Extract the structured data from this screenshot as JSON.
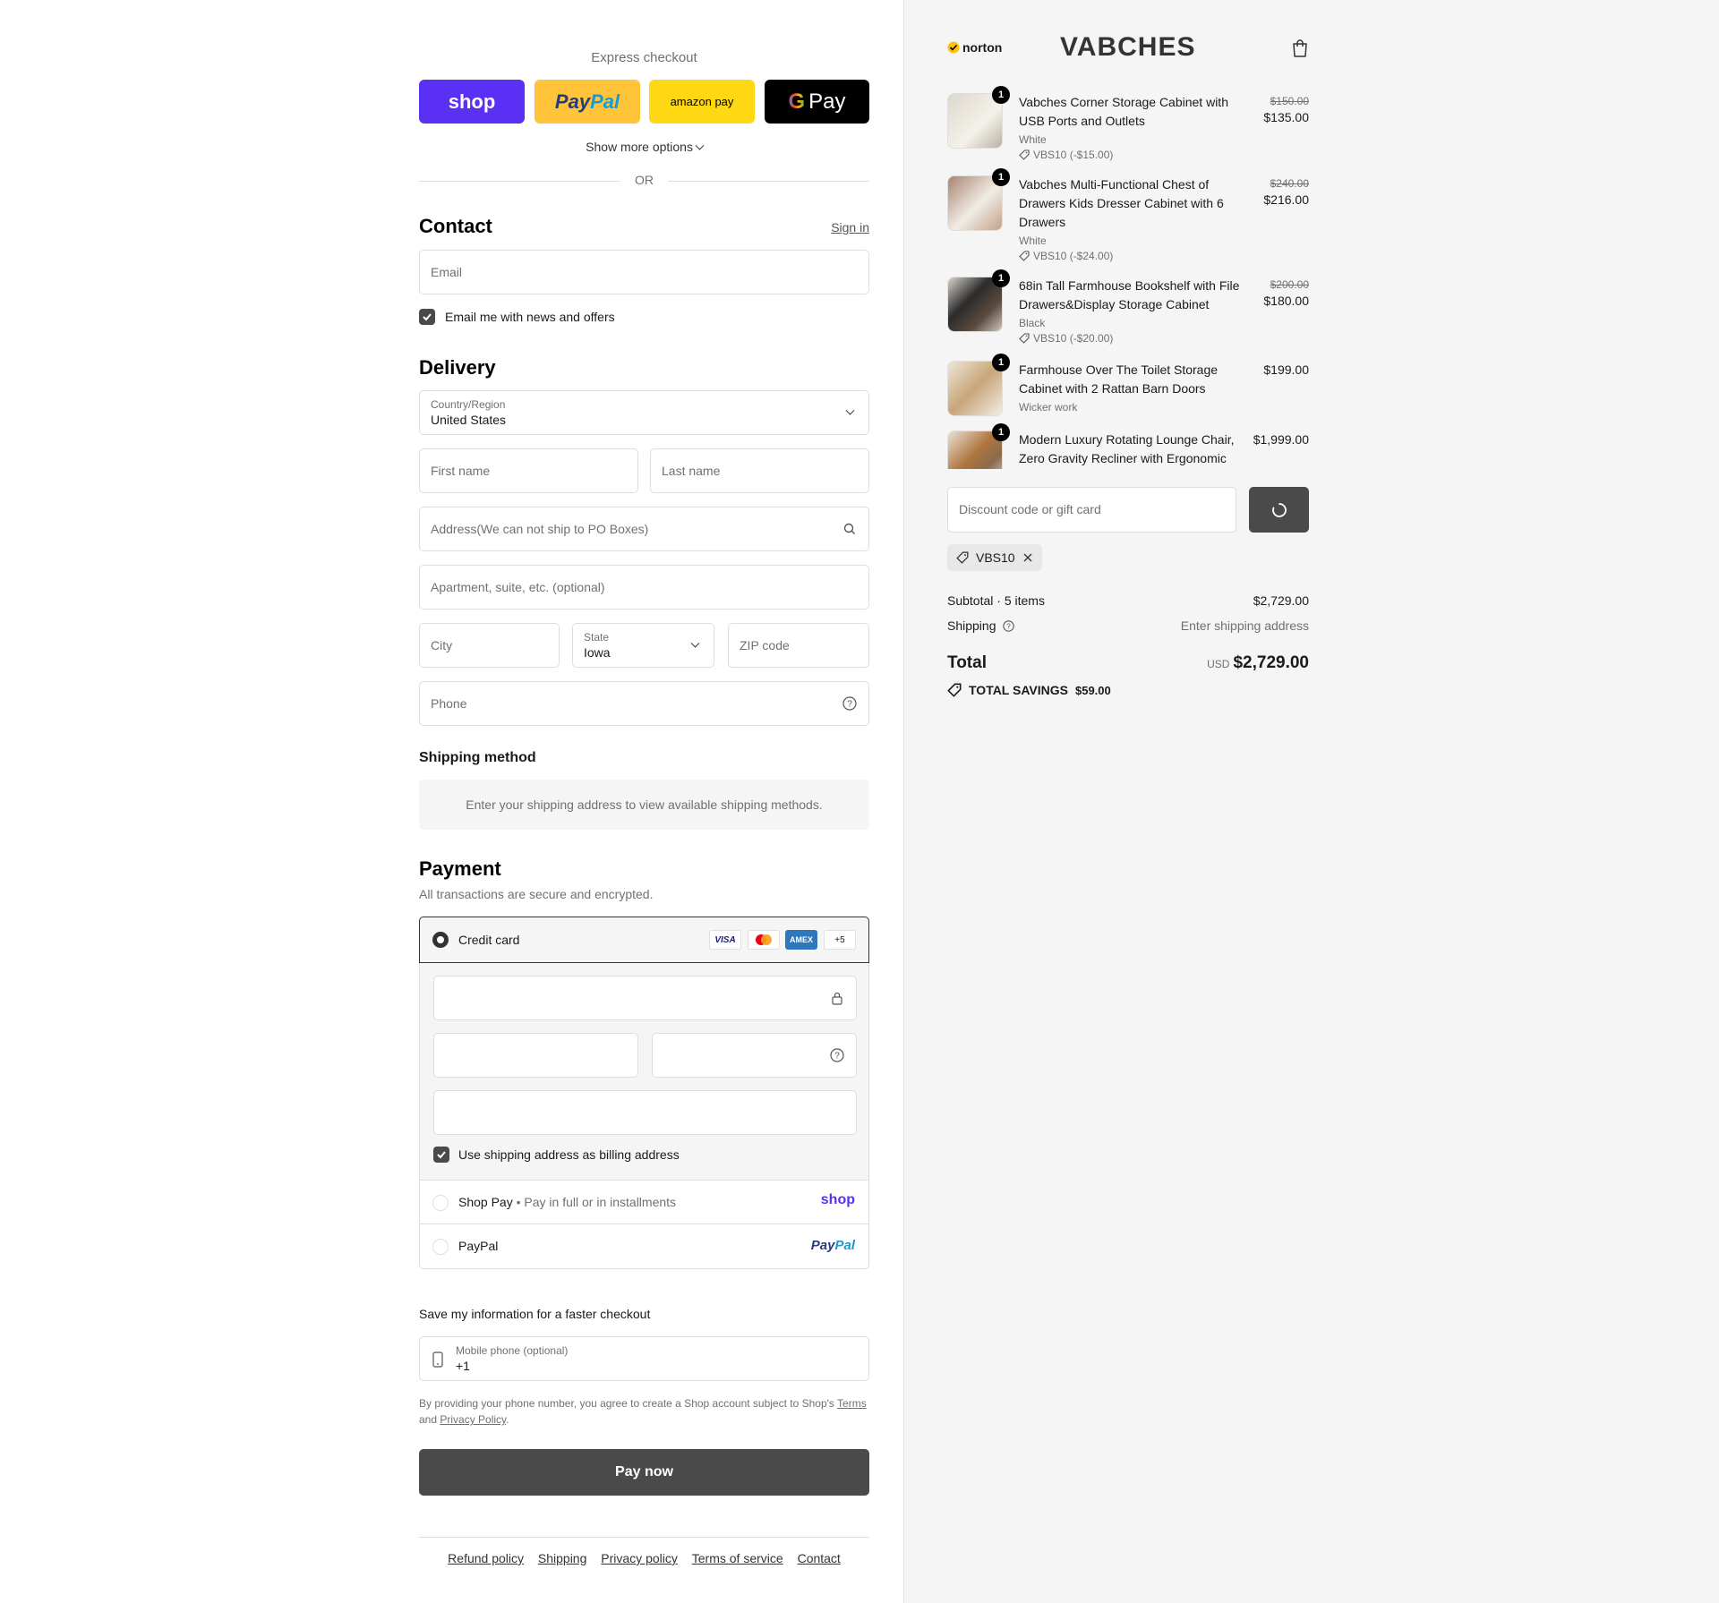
{
  "express": {
    "title": "Express checkout",
    "shop_label": "shop",
    "paypal_label_1": "Pay",
    "paypal_label_2": "Pal",
    "amazon_label": "amazon pay",
    "gpay_label": "Pay",
    "more_options": "Show more options",
    "or": "OR"
  },
  "contact": {
    "title": "Contact",
    "sign_in": "Sign in",
    "email_placeholder": "Email",
    "news_label": "Email me with news and offers"
  },
  "delivery": {
    "title": "Delivery",
    "country_label": "Country/Region",
    "country_value": "United States",
    "first_name": "First name",
    "last_name": "Last name",
    "address": "Address(We can not ship to PO Boxes)",
    "apartment": "Apartment, suite, etc. (optional)",
    "city": "City",
    "state_label": "State",
    "state_value": "Iowa",
    "zip": "ZIP code",
    "phone": "Phone"
  },
  "shipping_method": {
    "title": "Shipping method",
    "message": "Enter your shipping address to view available shipping methods."
  },
  "payment": {
    "title": "Payment",
    "subtitle": "All transactions are secure and encrypted.",
    "credit_card": "Credit card",
    "cards": [
      "VISA",
      "",
      "AMEX",
      "+5"
    ],
    "billing_label": "Use shipping address as billing address",
    "shop_pay": "Shop Pay",
    "shop_pay_sub": "Pay in full or in installments",
    "shop_pay_logo": "shop",
    "paypal": "PayPal",
    "paypal_logo_1": "Pay",
    "paypal_logo_2": "Pal"
  },
  "save_info": {
    "title": "Save my information for a faster checkout",
    "mobile_label": "Mobile phone (optional)",
    "mobile_value": "+1",
    "legal_1": "By providing your phone number, you agree to create a Shop account subject to Shop's ",
    "terms": "Terms",
    "legal_2": " and ",
    "privacy": "Privacy Policy",
    "legal_3": "."
  },
  "pay_now": "Pay now",
  "footer": [
    "Refund policy",
    "Shipping",
    "Privacy policy",
    "Terms of service",
    "Contact"
  ],
  "header": {
    "norton": "norton",
    "brand": "VABCHES"
  },
  "items": [
    {
      "qty": "1",
      "name": "Vabches Corner Storage Cabinet with USB Ports and Outlets",
      "variant": "White",
      "discount": "VBS10 (-$15.00)",
      "old_price": "$150.00",
      "price": "$135.00"
    },
    {
      "qty": "1",
      "name": "Vabches Multi-Functional Chest of Drawers Kids Dresser Cabinet with 6 Drawers",
      "variant": "White",
      "discount": "VBS10 (-$24.00)",
      "old_price": "$240.00",
      "price": "$216.00"
    },
    {
      "qty": "1",
      "name": "68in Tall Farmhouse Bookshelf with File Drawers&Display Storage Cabinet",
      "variant": "Black",
      "discount": "VBS10 (-$20.00)",
      "old_price": "$200.00",
      "price": "$180.00"
    },
    {
      "qty": "1",
      "name": "Farmhouse Over The Toilet Storage Cabinet with 2 Rattan Barn Doors",
      "variant": "Wicker work",
      "discount": "",
      "old_price": "",
      "price": "$199.00"
    },
    {
      "qty": "1",
      "name": "Modern Luxury Rotating Lounge Chair, Zero Gravity Recliner with Ergonomic Support",
      "variant": "",
      "discount": "",
      "old_price": "",
      "price": "$1,999.00"
    }
  ],
  "discount": {
    "placeholder": "Discount code or gift card",
    "code": "VBS10"
  },
  "summary": {
    "subtotal_label": "Subtotal · 5 items",
    "subtotal_value": "$2,729.00",
    "shipping_label": "Shipping",
    "shipping_value": "Enter shipping address",
    "total_label": "Total",
    "currency": "USD",
    "total_value": "$2,729.00",
    "savings_label": "TOTAL SAVINGS",
    "savings_value": "$59.00"
  },
  "colors": {
    "shop_purple": "#5a31f4",
    "paypal_yellow": "#ffc439",
    "amazon_yellow": "#ffd814",
    "button_dark": "#4a4a4a"
  }
}
